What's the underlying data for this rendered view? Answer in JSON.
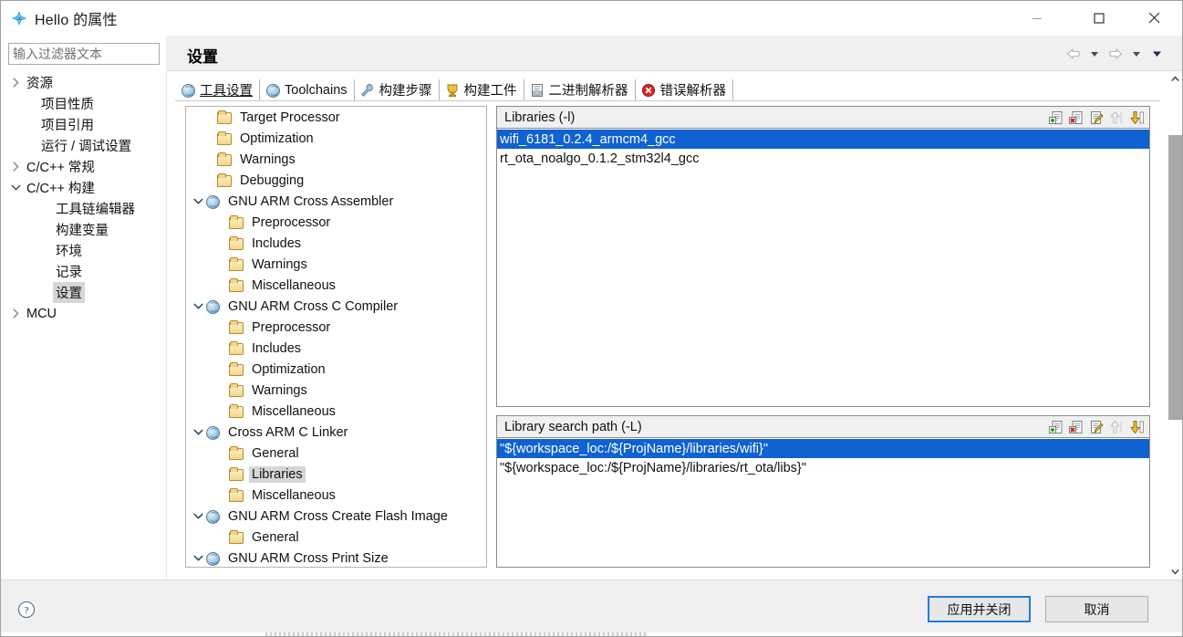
{
  "window": {
    "title": "Hello 的属性",
    "icon": "eclipse-star-icon",
    "minimize_label": "最小化",
    "maximize_label": "最大化",
    "close_label": "关闭"
  },
  "sidebar": {
    "filter": {
      "value": "",
      "placeholder": "输入过滤器文本"
    },
    "items": [
      {
        "label": "资源",
        "indent": 0,
        "arrow": "right",
        "selected": false
      },
      {
        "label": "项目性质",
        "indent": 1,
        "arrow": "none",
        "selected": false
      },
      {
        "label": "项目引用",
        "indent": 1,
        "arrow": "none",
        "selected": false
      },
      {
        "label": "运行 / 调试设置",
        "indent": 1,
        "arrow": "none",
        "selected": false
      },
      {
        "label": "C/C++ 常规",
        "indent": 0,
        "arrow": "right",
        "selected": false
      },
      {
        "label": "C/C++ 构建",
        "indent": 0,
        "arrow": "down",
        "selected": false
      },
      {
        "label": "工具链编辑器",
        "indent": 2,
        "arrow": "none",
        "selected": false
      },
      {
        "label": "构建变量",
        "indent": 2,
        "arrow": "none",
        "selected": false
      },
      {
        "label": "环境",
        "indent": 2,
        "arrow": "none",
        "selected": false
      },
      {
        "label": "记录",
        "indent": 2,
        "arrow": "none",
        "selected": false
      },
      {
        "label": "设置",
        "indent": 2,
        "arrow": "none",
        "selected": true
      },
      {
        "label": "MCU",
        "indent": 0,
        "arrow": "right",
        "selected": false
      }
    ]
  },
  "header": {
    "title": "设置",
    "nav": {
      "back_label": "后退",
      "back_menu_label": "后退历史",
      "forward_label": "前进",
      "forward_menu_label": "前进历史",
      "view_menu_label": "视图菜单"
    }
  },
  "tabs": [
    {
      "label": "工具设置",
      "icon": "globe-icon",
      "active": true
    },
    {
      "label": "Toolchains",
      "icon": "globe-icon",
      "active": false
    },
    {
      "label": "构建步骤",
      "icon": "wrench-icon",
      "active": false
    },
    {
      "label": "构建工件",
      "icon": "trophy-icon",
      "active": false
    },
    {
      "label": "二进制解析器",
      "icon": "binary-icon",
      "active": false
    },
    {
      "label": "错误解析器",
      "icon": "error-icon",
      "active": false
    }
  ],
  "options_tree": [
    {
      "label": "Target Processor",
      "indent": 1,
      "arrow": "none",
      "icon": "folder-icon",
      "selected": false
    },
    {
      "label": "Optimization",
      "indent": 1,
      "arrow": "none",
      "icon": "folder-icon",
      "selected": false
    },
    {
      "label": "Warnings",
      "indent": 1,
      "arrow": "none",
      "icon": "folder-icon",
      "selected": false
    },
    {
      "label": "Debugging",
      "indent": 1,
      "arrow": "none",
      "icon": "folder-icon",
      "selected": false
    },
    {
      "label": "GNU ARM Cross Assembler",
      "indent": 0,
      "arrow": "down",
      "icon": "globe-icon",
      "selected": false
    },
    {
      "label": "Preprocessor",
      "indent": 2,
      "arrow": "none",
      "icon": "folder-icon",
      "selected": false
    },
    {
      "label": "Includes",
      "indent": 2,
      "arrow": "none",
      "icon": "folder-icon",
      "selected": false
    },
    {
      "label": "Warnings",
      "indent": 2,
      "arrow": "none",
      "icon": "folder-icon",
      "selected": false
    },
    {
      "label": "Miscellaneous",
      "indent": 2,
      "arrow": "none",
      "icon": "folder-icon",
      "selected": false
    },
    {
      "label": "GNU ARM Cross C Compiler",
      "indent": 0,
      "arrow": "down",
      "icon": "globe-icon",
      "selected": false
    },
    {
      "label": "Preprocessor",
      "indent": 2,
      "arrow": "none",
      "icon": "folder-icon",
      "selected": false
    },
    {
      "label": "Includes",
      "indent": 2,
      "arrow": "none",
      "icon": "folder-icon",
      "selected": false
    },
    {
      "label": "Optimization",
      "indent": 2,
      "arrow": "none",
      "icon": "folder-icon",
      "selected": false
    },
    {
      "label": "Warnings",
      "indent": 2,
      "arrow": "none",
      "icon": "folder-icon",
      "selected": false
    },
    {
      "label": "Miscellaneous",
      "indent": 2,
      "arrow": "none",
      "icon": "folder-icon",
      "selected": false
    },
    {
      "label": "Cross ARM C Linker",
      "indent": 0,
      "arrow": "down",
      "icon": "globe-icon",
      "selected": false
    },
    {
      "label": "General",
      "indent": 2,
      "arrow": "none",
      "icon": "folder-icon",
      "selected": false
    },
    {
      "label": "Libraries",
      "indent": 2,
      "arrow": "none",
      "icon": "folder-icon",
      "selected": true
    },
    {
      "label": "Miscellaneous",
      "indent": 2,
      "arrow": "none",
      "icon": "folder-icon",
      "selected": false
    },
    {
      "label": "GNU ARM Cross Create Flash Image",
      "indent": 0,
      "arrow": "down",
      "icon": "globe-icon",
      "selected": false
    },
    {
      "label": "General",
      "indent": 2,
      "arrow": "none",
      "icon": "folder-icon",
      "selected": false
    },
    {
      "label": "GNU ARM Cross Print Size",
      "indent": 0,
      "arrow": "down",
      "icon": "globe-icon",
      "selected": false
    }
  ],
  "panels": {
    "libraries": {
      "title": "Libraries (-l)",
      "tools": [
        {
          "name": "add-icon",
          "label": "Add..."
        },
        {
          "name": "delete-icon",
          "label": "Delete"
        },
        {
          "name": "edit-icon",
          "label": "Edit..."
        },
        {
          "name": "move-up-icon",
          "label": "Move Up"
        },
        {
          "name": "move-down-icon",
          "label": "Move Down"
        }
      ],
      "items": [
        {
          "value": "wifi_6181_0.2.4_armcm4_gcc",
          "selected": true
        },
        {
          "value": "rt_ota_noalgo_0.1.2_stm32l4_gcc",
          "selected": false
        }
      ]
    },
    "library_search_path": {
      "title": "Library search path (-L)",
      "tools": [
        {
          "name": "add-icon",
          "label": "Add..."
        },
        {
          "name": "delete-icon",
          "label": "Delete"
        },
        {
          "name": "edit-icon",
          "label": "Edit..."
        },
        {
          "name": "move-up-icon",
          "label": "Move Up"
        },
        {
          "name": "move-down-icon",
          "label": "Move Down"
        }
      ],
      "items": [
        {
          "value": "\"${workspace_loc:/${ProjName}/libraries/wifi}\"",
          "selected": true
        },
        {
          "value": "\"${workspace_loc:/${ProjName}/libraries/rt_ota/libs}\"",
          "selected": false
        }
      ]
    }
  },
  "footer": {
    "help_label": "帮助",
    "apply_and_close": "应用并关闭",
    "cancel": "取消"
  },
  "colors": {
    "selection_blue": "#0f62d0",
    "focus_border": "#1f7fd4",
    "panel_bg": "#f0f0f0",
    "tree_selection_grey": "#d6d6d6"
  }
}
